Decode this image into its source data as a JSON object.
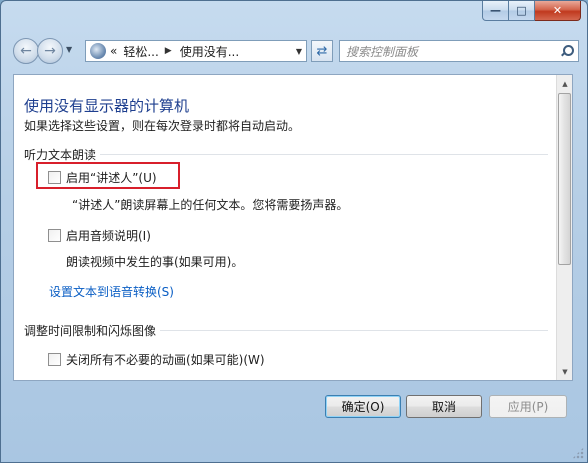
{
  "window": {
    "caption_min_icon": "minimize-icon",
    "caption_max_icon": "maximize-icon",
    "caption_close_icon": "close-icon"
  },
  "navbar": {
    "breadcrumb_prefix": "«",
    "breadcrumbs": [
      "轻松...",
      "使用没有..."
    ],
    "search_placeholder": "搜索控制面板"
  },
  "page": {
    "title": "使用没有显示器的计算机",
    "subtitle": "如果选择这些设置，则在每次登录时都将自动启动。"
  },
  "sections": [
    {
      "heading": "听力文本朗读",
      "options": [
        {
          "label": "启用“讲述人”(U)",
          "description": "“讲述人”朗读屏幕上的任何文本。您将需要扬声器。",
          "checked": false
        },
        {
          "label": "启用音频说明(I)",
          "description": "朗读视频中发生的事(如果可用)。",
          "checked": false
        }
      ],
      "link": "设置文本到语音转换(S)"
    },
    {
      "heading": "调整时间限制和闪烁图像",
      "options": [
        {
          "label": "关闭所有不必要的动画(如果可能)(W)",
          "checked": false
        }
      ]
    }
  ],
  "buttons": {
    "ok": "确定(O)",
    "cancel": "取消",
    "apply": "应用(P)"
  },
  "colors": {
    "title_blue": "#1e3f8f",
    "link_blue": "#0a5ec4",
    "highlight_red": "#d81f2b"
  }
}
